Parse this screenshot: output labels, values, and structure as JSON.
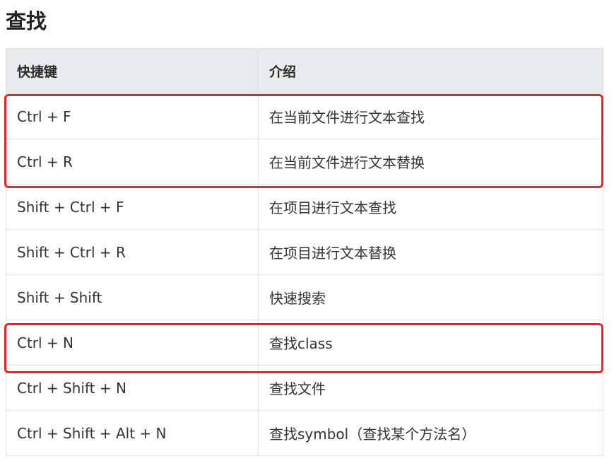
{
  "title": "查找",
  "table": {
    "headers": [
      "快捷键",
      "介绍"
    ],
    "rows": [
      {
        "shortcut": "Ctrl + F",
        "description": "在当前文件进行文本查找"
      },
      {
        "shortcut": "Ctrl + R",
        "description": "在当前文件进行文本替换"
      },
      {
        "shortcut": "Shift + Ctrl + F",
        "description": "在项目进行文本查找"
      },
      {
        "shortcut": "Shift + Ctrl + R",
        "description": "在项目进行文本替换"
      },
      {
        "shortcut": "Shift + Shift",
        "description": "快速搜索"
      },
      {
        "shortcut": "Ctrl + N",
        "description": "查找class"
      },
      {
        "shortcut": "Ctrl + Shift + N",
        "description": "查找文件"
      },
      {
        "shortcut": "Ctrl + Shift + Alt + N",
        "description": "查找symbol（查找某个方法名）"
      }
    ]
  },
  "colors": {
    "highlight_border": "#e8262a",
    "header_background": "#e8ebee",
    "table_border": "#dfe2e5"
  }
}
